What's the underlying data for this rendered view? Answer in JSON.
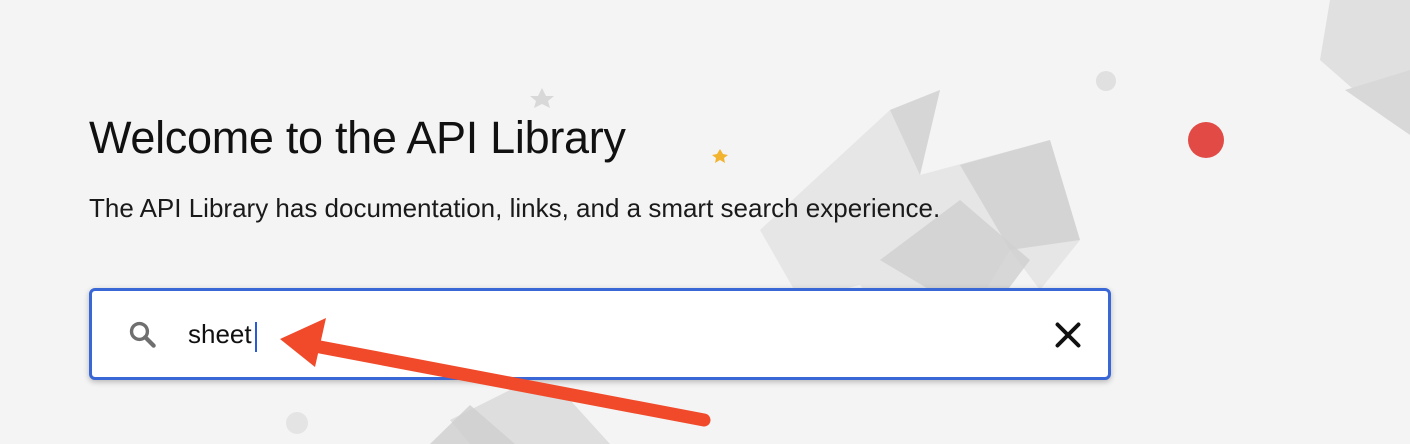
{
  "header": {
    "title": "Welcome to the API Library",
    "subtitle": "The API Library has documentation, links, and a smart search experience."
  },
  "search": {
    "value": "sheet",
    "icon": "search-icon",
    "clear_icon": "close-icon"
  },
  "annotation": {
    "icon": "red-arrow",
    "color": "#f04a2a"
  },
  "colors": {
    "search_border": "#3a67d6",
    "decor_red_dot": "#e24a45",
    "decor_yellow_star": "#f2b430"
  }
}
